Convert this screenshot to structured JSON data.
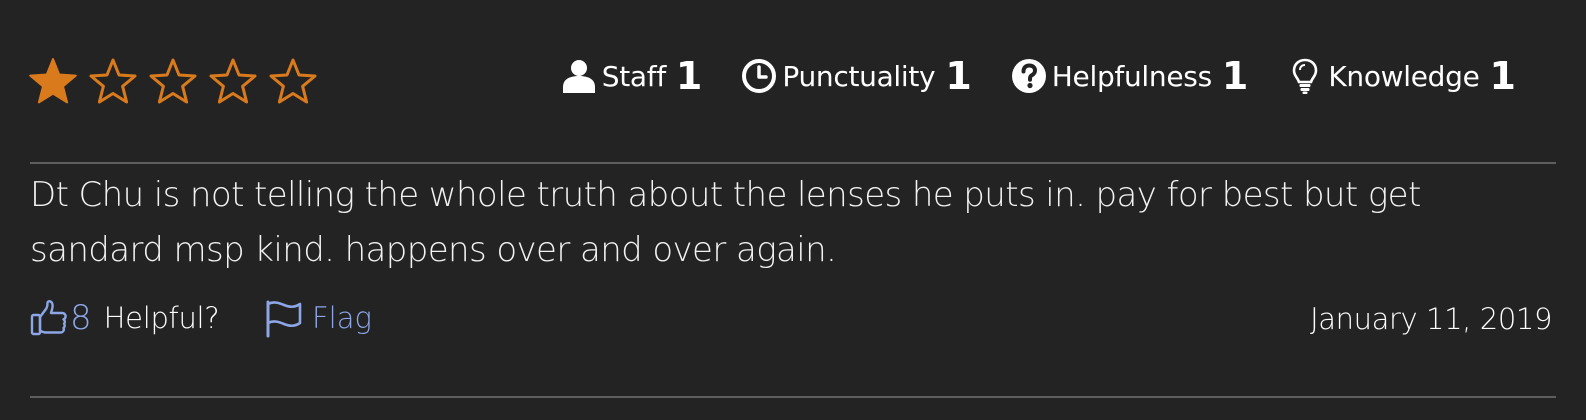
{
  "rating": {
    "value": 1,
    "max": 5,
    "filled_color": "#d97a1c",
    "outline_color": "#d97a1c"
  },
  "metrics": [
    {
      "label": "Staff",
      "value": "1",
      "icon": "user-icon"
    },
    {
      "label": "Punctuality",
      "value": "1",
      "icon": "clock-icon"
    },
    {
      "label": "Helpfulness",
      "value": "1",
      "icon": "question-circle-icon"
    },
    {
      "label": "Knowledge",
      "value": "1",
      "icon": "lightbulb-icon"
    }
  ],
  "review": {
    "text": "Dt Chu is not telling the whole truth about the lenses he puts in. pay for best but get sandard msp kind. happens over and over again.",
    "helpful_count": "8",
    "helpful_label": "Helpful?",
    "flag_label": "Flag",
    "date": "January 11, 2019"
  },
  "colors": {
    "background": "#232323",
    "accent": "#8da6e6",
    "divider": "#5e5e5e"
  }
}
